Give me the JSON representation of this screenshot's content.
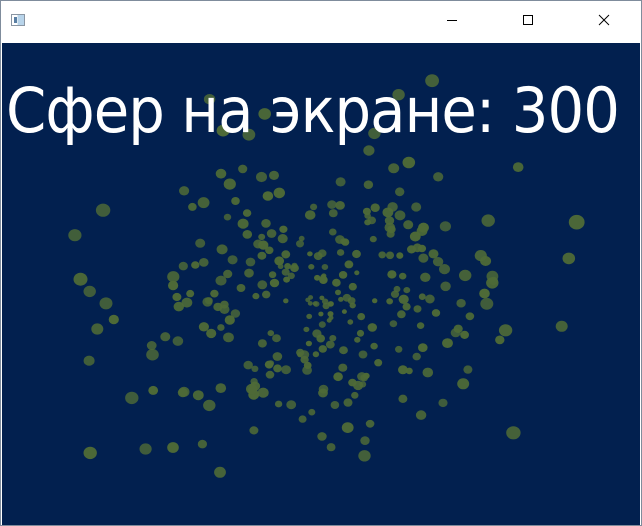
{
  "window": {
    "title": "",
    "icon": "app-window-icon",
    "controls": [
      "minimize-icon",
      "maximize-icon",
      "close-icon"
    ]
  },
  "scene": {
    "background_color": "#02204f",
    "sphere_color": "#4e6a37",
    "sphere_count_label": "Сфер на экране: 300",
    "sphere_count": 300
  }
}
